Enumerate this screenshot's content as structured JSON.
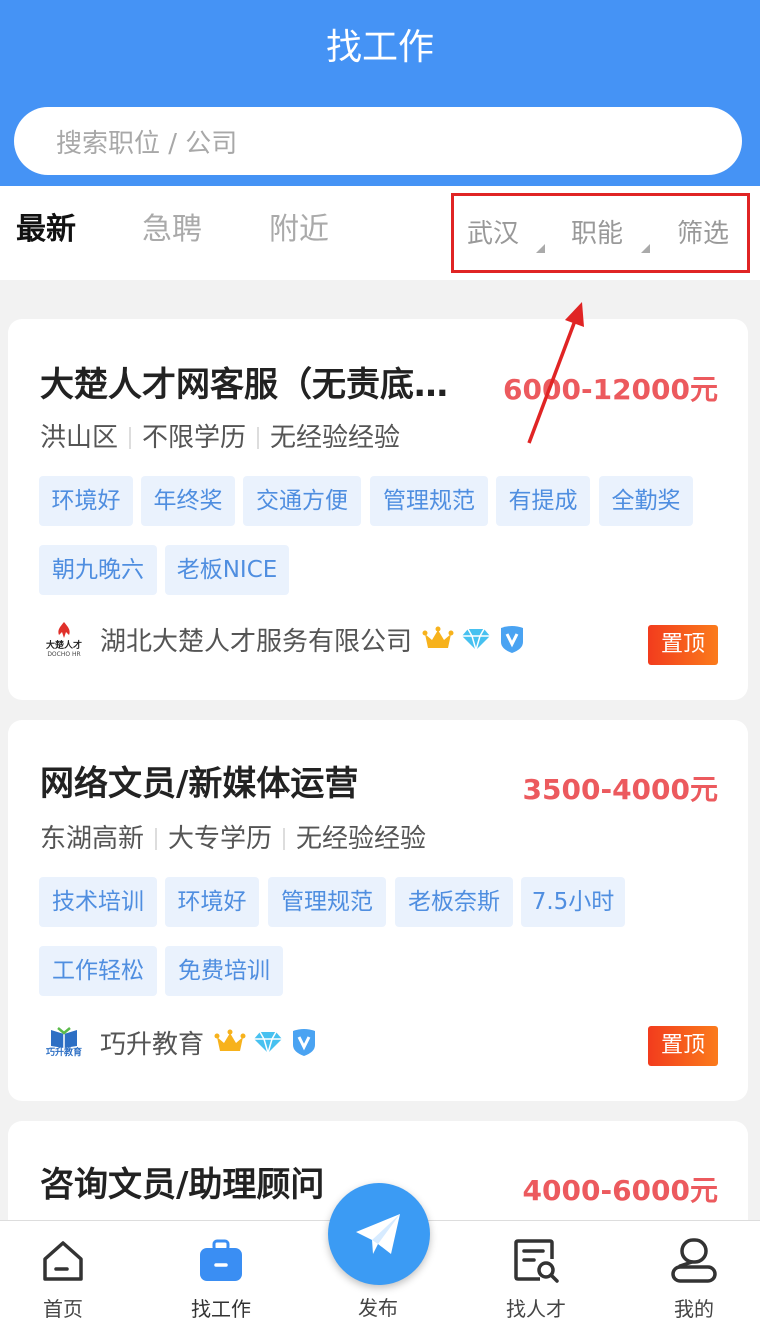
{
  "header": {
    "title": "找工作",
    "search_placeholder": "搜索职位 / 公司"
  },
  "tabs": [
    {
      "label": "最新",
      "active": true
    },
    {
      "label": "急聘",
      "active": false
    },
    {
      "label": "附近",
      "active": false
    }
  ],
  "filters": [
    {
      "label": "武汉",
      "has_dropdown": true
    },
    {
      "label": "职能",
      "has_dropdown": true
    },
    {
      "label": "筛选",
      "has_dropdown": false
    }
  ],
  "jobs": [
    {
      "title": "大楚人才网客服（无责底…",
      "salary": "6000-12000元",
      "location": "洪山区",
      "education": "不限学历",
      "experience": "无经验经验",
      "tags": [
        "环境好",
        "年终奖",
        "交通方便",
        "管理规范",
        "有提成",
        "全勤奖",
        "朝九晚六",
        "老板NICE"
      ],
      "company": "湖北大楚人才服务有限公司",
      "logo_text": "大楚人才",
      "logo_sub": "DOCHO HR",
      "pinned_label": "置顶"
    },
    {
      "title": "网络文员/新媒体运营",
      "salary": "3500-4000元",
      "location": "东湖高新",
      "education": "大专学历",
      "experience": "无经验经验",
      "tags": [
        "技术培训",
        "环境好",
        "管理规范",
        "老板奈斯",
        "7.5小时",
        "工作轻松",
        "免费培训"
      ],
      "company": "巧升教育",
      "logo_text": "巧升教育",
      "pinned_label": "置顶"
    },
    {
      "title": "咨询文员/助理顾问",
      "salary": "4000-6000元"
    }
  ],
  "colors": {
    "primary": "#4593f5",
    "salary": "#ec5a5e",
    "tag_bg": "#eaf2fd",
    "tag_text": "#4f8ee0",
    "annotation": "#e02424"
  },
  "nav": [
    {
      "label": "首页",
      "icon": "home-icon"
    },
    {
      "label": "找工作",
      "icon": "briefcase-icon",
      "active": true
    },
    {
      "label": "发布",
      "icon": "paper-plane-icon"
    },
    {
      "label": "找人才",
      "icon": "search-document-icon"
    },
    {
      "label": "我的",
      "icon": "user-icon"
    }
  ]
}
